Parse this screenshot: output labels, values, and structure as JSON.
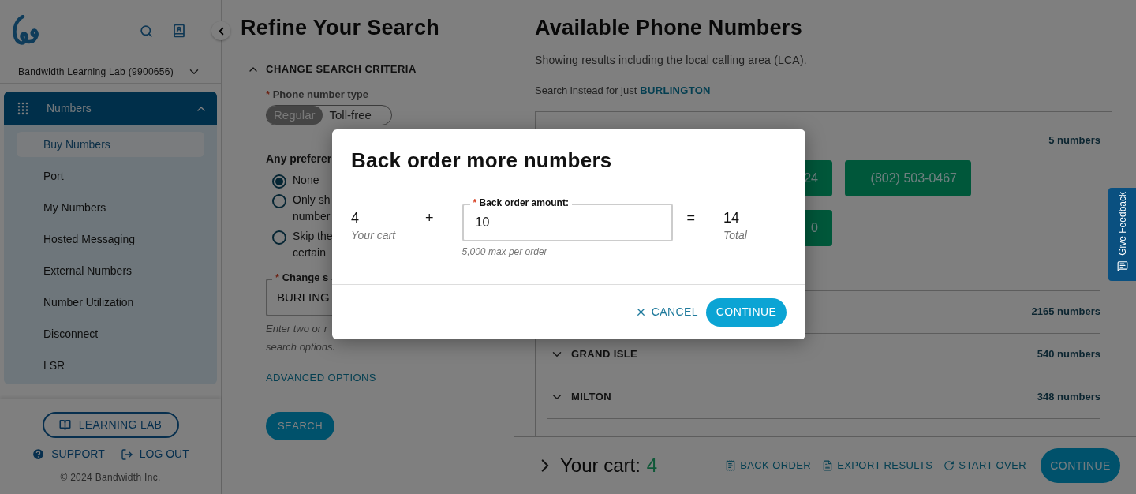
{
  "sidebar": {
    "account": "Bandwidth Learning Lab (9900656)",
    "nav": {
      "label": "Numbers",
      "expanded": true,
      "children": [
        {
          "label": "Buy Numbers",
          "selected": true
        },
        {
          "label": "Port",
          "selected": false
        },
        {
          "label": "My Numbers",
          "selected": false
        },
        {
          "label": "Hosted Messaging",
          "selected": false
        },
        {
          "label": "External Numbers",
          "selected": false
        },
        {
          "label": "Number Utilization",
          "selected": false
        },
        {
          "label": "Disconnect",
          "selected": false
        },
        {
          "label": "LSR",
          "selected": false
        }
      ]
    },
    "learning_lab": "LEARNING LAB",
    "support": "SUPPORT",
    "logout": "LOG OUT",
    "copyright": "© 2024 Bandwidth Inc."
  },
  "search_panel": {
    "title": "Refine Your Search",
    "section": {
      "label": "CHANGE SEARCH CRITERIA",
      "expanded": true
    },
    "phone_type": {
      "required_mark": "*",
      "label": "Phone number type",
      "options": [
        {
          "label": "Regular",
          "selected": true
        },
        {
          "label": "Toll-free",
          "selected": false
        }
      ]
    },
    "preference": {
      "label": "Any preferer",
      "options": [
        {
          "lines": [
            "None"
          ],
          "selected": true
        },
        {
          "lines": [
            "Only sh",
            "number"
          ],
          "selected": false
        },
        {
          "lines": [
            "Skip the",
            "certain"
          ],
          "selected": false
        }
      ]
    },
    "city": {
      "required_mark": "*",
      "label": "Change s",
      "value": "BURLING",
      "hint": [
        "Enter two or r",
        "search options."
      ]
    },
    "advanced": "ADVANCED OPTIONS",
    "search": "SEARCH"
  },
  "results": {
    "title": "Available Phone Numbers",
    "subtitle": "Showing results including the local calling area (LCA).",
    "search_instead": {
      "text": "Search instead for just",
      "link": "BURLINGTON"
    },
    "groups": [
      {
        "count": "5 numbers",
        "numbers": [
          "24",
          "(802) 503-0467",
          "0"
        ]
      },
      {
        "count": "2165 numbers"
      },
      {
        "name": "GRAND ISLE",
        "count": "540 numbers",
        "expanded": false
      },
      {
        "name": "MILTON",
        "count": "348 numbers",
        "expanded": false
      }
    ]
  },
  "cart": {
    "label": "Your cart:",
    "count": "4",
    "actions": [
      "BACK ORDER",
      "EXPORT RESULTS",
      "START OVER"
    ],
    "continue": "CONTINUE"
  },
  "feedback": "Give Feedback",
  "modal": {
    "title": "Back order more numbers",
    "cart": {
      "value": "4",
      "label": "Your cart"
    },
    "plus": "+",
    "field": {
      "label": "Back order amount:",
      "value": "10",
      "hint": "5,000 max per order",
      "required_mark": "*"
    },
    "equals": "=",
    "total": {
      "value": "14",
      "label": "Total"
    },
    "cancel": "CANCEL",
    "continue": "CONTINUE"
  }
}
